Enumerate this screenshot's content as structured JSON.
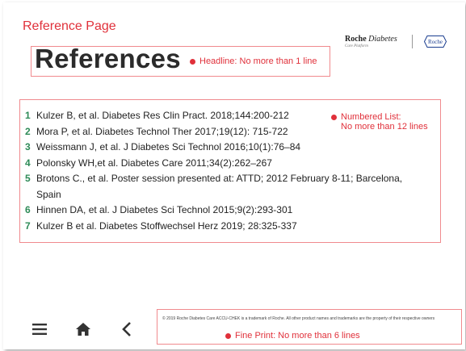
{
  "page_label": "Reference Page",
  "brand": {
    "name_bold": "Roche",
    "name_italic": "Diabetes",
    "sub": "Care Platform",
    "logo_text": "Roche"
  },
  "headline": "References",
  "headline_note": "Headline: No more than 1 line",
  "list_note": [
    "Numbered List:",
    "No more than 12 lines"
  ],
  "references": [
    {
      "num": "1",
      "text": "Kulzer B, et al. Diabetes Res Clin Pract. 2018;144:200-212"
    },
    {
      "num": "2",
      "text": "Mora P, et al. Diabetes Technol Ther 2017;19(12): 715-722"
    },
    {
      "num": "3",
      "text": "Weissmann J, et al. J Diabetes Sci Technol 2016;10(1):76–84"
    },
    {
      "num": "4",
      "text": "Polonsky WH,et al. Diabetes Care 2011;34(2):262–267"
    },
    {
      "num": "5",
      "text": "Brotons C., et al. Poster session presented at: ATTD; 2012 February 8-11; Barcelona, Spain"
    },
    {
      "num": "6",
      "text": "Hinnen DA, et al. J Diabetes Sci Technol 2015;9(2):293-301"
    },
    {
      "num": "7",
      "text": "Kulzer B et al. Diabetes Stoffwechsel Herz 2019; 28:325-337"
    }
  ],
  "fine_print": "© 2019 Roche Diabetes Care ACCU-CHEK is a trademark of Roche. All other product names and trademarks are the property of their respective owners",
  "fine_print_note": "Fine Print: No more than 6 lines",
  "nav": {
    "menu_icon": "hamburger-menu-icon",
    "home_icon": "home-icon",
    "back_icon": "chevron-left-icon"
  },
  "colors": {
    "accent_red": "#e0303a",
    "number_green": "#2e8b57",
    "note_border": "#f08a8e",
    "roche_blue": "#1a3d8f"
  }
}
